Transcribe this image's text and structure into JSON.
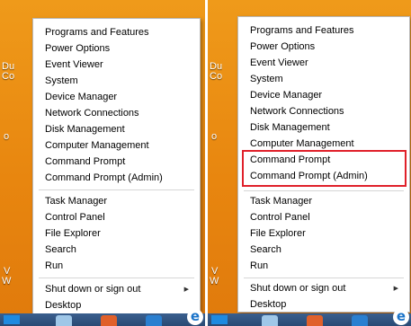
{
  "colors": {
    "highlight_border": "#e0202a",
    "desktop_background": "#e8860f",
    "menu_background": "#ffffff"
  },
  "desktop_icons": {
    "left": [
      "Du",
      "Co",
      "o",
      "V",
      "W"
    ],
    "right": [
      "Du",
      "Co",
      "o",
      "V",
      "W"
    ]
  },
  "menu": {
    "group1": [
      "Programs and Features",
      "Power Options",
      "Event Viewer",
      "System",
      "Device Manager",
      "Network Connections",
      "Disk Management",
      "Computer Management",
      "Command Prompt",
      "Command Prompt (Admin)"
    ],
    "group2": [
      "Task Manager",
      "Control Panel",
      "File Explorer",
      "Search",
      "Run"
    ],
    "group3": [
      "Shut down or sign out",
      "Desktop"
    ],
    "submenu_arrow": "▶"
  },
  "taskbar": {
    "ie_glyph": "e",
    "icons": [
      "start-icon",
      "file-explorer-icon",
      "firefox-icon",
      "store-icon",
      "internet-explorer-icon"
    ]
  },
  "highlighted_items": [
    "Command Prompt",
    "Command Prompt (Admin)"
  ]
}
